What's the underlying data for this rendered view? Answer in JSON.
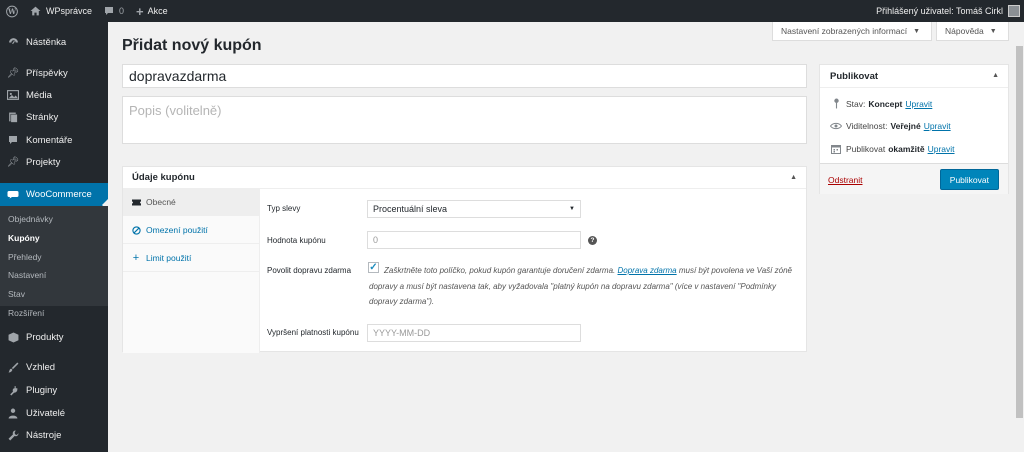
{
  "adminbar": {
    "site_name": "WPsprávce",
    "comments_count": "0",
    "new_label": "Akce",
    "greeting": "Přihlášený uživatel: Tomáš Cirkl"
  },
  "sidebar": {
    "items": [
      {
        "label": "Nástěnka",
        "icon": "dashboard-icon"
      },
      {
        "label": "Příspěvky",
        "icon": "pin-icon"
      },
      {
        "label": "Média",
        "icon": "media-icon"
      },
      {
        "label": "Stránky",
        "icon": "page-icon"
      },
      {
        "label": "Komentáře",
        "icon": "comment-icon"
      },
      {
        "label": "Projekty",
        "icon": "pin-icon"
      },
      {
        "label": "WooCommerce",
        "icon": "woo-icon"
      },
      {
        "label": "Produkty",
        "icon": "box-icon"
      },
      {
        "label": "Vzhled",
        "icon": "brush-icon"
      },
      {
        "label": "Pluginy",
        "icon": "plug-icon"
      },
      {
        "label": "Uživatelé",
        "icon": "user-icon"
      },
      {
        "label": "Nástroje",
        "icon": "wrench-icon"
      }
    ],
    "submenu": [
      "Objednávky",
      "Kupóny",
      "Přehledy",
      "Nastavení",
      "Stav",
      "Rozšíření"
    ]
  },
  "screen_options": {
    "label": "Nastavení zobrazených informací"
  },
  "help": {
    "label": "Nápověda"
  },
  "page": {
    "title": "Přidat nový kupón",
    "coupon_code": "dopravazdarma",
    "description_placeholder": "Popis (volitelně)"
  },
  "coupon_data": {
    "heading": "Údaje kupónu",
    "tabs": [
      "Obecné",
      "Omezení použití",
      "Limit použití"
    ],
    "fields": {
      "discount_type_label": "Typ slevy",
      "discount_type_value": "Procentuální sleva",
      "amount_label": "Hodnota kupónu",
      "amount_placeholder": "0",
      "free_shipping_label": "Povolit dopravu zdarma",
      "free_shipping_desc_1": "Zaškrtněte toto políčko, pokud kupón garantuje doručení zdarma.",
      "free_shipping_link": "Doprava zdarma",
      "free_shipping_desc_2": "musí být povolena ve Vaší zóně dopravy a musí být nastavena tak, aby vyžadovala \"platný kupón na dopravu zdarma\" (více v nastavení \"Podmínky dopravy zdarma\").",
      "expiry_label": "Vypršení platnosti kupónu",
      "expiry_placeholder": "YYYY-MM-DD"
    }
  },
  "publish": {
    "heading": "Publikovat",
    "status_label": "Stav:",
    "status_value": "Koncept",
    "visibility_label": "Viditelnost:",
    "visibility_value": "Veřejné",
    "schedule_label": "Publikovat",
    "schedule_value": "okamžitě",
    "edit_link": "Upravit",
    "trash": "Odstranit",
    "button": "Publikovat"
  }
}
